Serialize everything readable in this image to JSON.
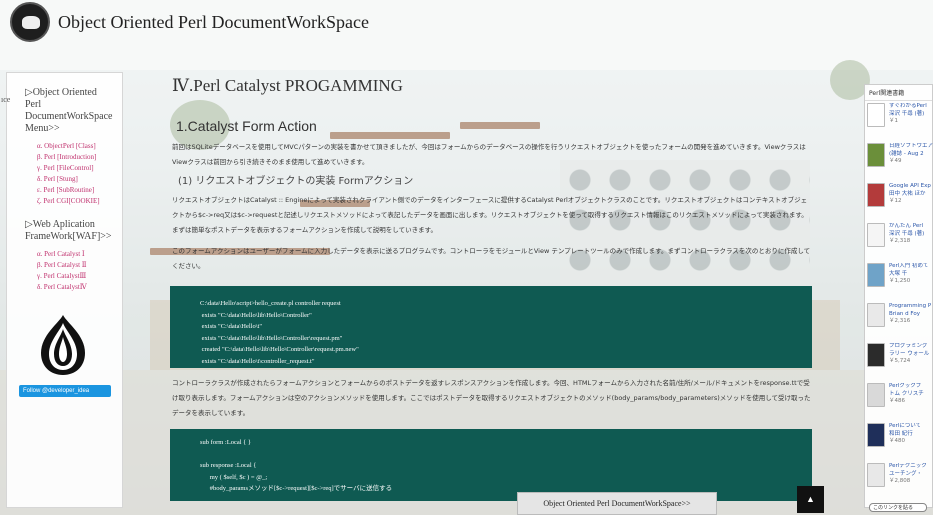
{
  "header": {
    "site_title": "Object Oriented Perl DocumentWorkSpace"
  },
  "left_sidebar": {
    "tab_fragment": "ıce",
    "section1_title": "▷Object Oriented Perl DocumentWorkSpace Menu>>",
    "section1_items": [
      "α. ObjectPerl [Class]",
      "β. Perl [Introduction]",
      "γ. Perl [FileControl]",
      "δ. Perl [Stung]",
      "ε. Perl [SubRoutine]",
      "ζ. Perl CGI[COOKIE]"
    ],
    "section2_title": "▷Web Aplication FrameWork[WAF]>>",
    "section2_items": [
      "α. Perl Catalyst Ⅰ",
      "β. Perl Catalyst Ⅱ",
      "γ. Perl CatalystⅢ",
      "δ. Perl CatalystⅣ"
    ],
    "follow_label": "Follow @developer_idea"
  },
  "main": {
    "chapter_title": "Ⅳ.Perl Catalyst PROGAMMING",
    "section_title": "1.Catalyst Form Action",
    "intro": "前回はSQLiteデータベースを使用してMVCパターンの実装を書かせて頂きましたが、今回はフォームからのデータベースの操作を行うリクエストオブジェクトを使ったフォームの開発を進めていきます。Viewクラスは Viewクラスは前回から引き続きそのまま使用して進めていきます。",
    "subsection_title": "(1) リクエストオブジェクトの実装 Formアクション",
    "para1": "リクエストオブジェクトはCatalyst :: Engineによって実装されクライアント側でのデータをインターフェースに提供するCatalyst Perlオブジェクトクラスのことです。リクエストオブジェクトはコンテキストオブジェクトから$c->req又は$c->requestと記述しリクエストメソッドによって表記したデータを画面に出します。リクエストオブジェクトを使って取得するリクエスト情報はこのリクエストメソッドによって実装されます。まずは簡単なポストデータを表示するフォームアクションを作成して説明をしていきます。",
    "para2": "このフォームアクションはユーザーがフォームに入力したデータを表示に送るプログラムです。コントローラをモジュールとView テンプレートツールのみで作成します。まずコントローラクラスを次のとおりに作成してください。",
    "code1": "C:\\data\\Hello\\script>hello_create.pl controller request\n exists \"C:\\data\\Hello\\lib\\Hello\\Controller\"\n exists \"C:\\data\\Hello\\t\"\n exists \"C:\\data\\Hello\\lib\\Hello\\Controller\\request.pm\"\n created \"C:\\data\\Hello\\lib\\Hello\\Controller\\request.pm.new\"\n exists \"C:\\data\\Hello\\t\\controller_request.t\"",
    "para3": "コントローラクラスが作成されたらフォームアクションとフォームからのポストデータを返すレスポンスアクションを作成します。今回、HTMLフォームから入力された名前/住所/メール/ドキュメントをresponse.ttで受け取り表示します。フォームアクションは空のアクションメソッドを使用します。ここではポストデータを取得するリクエストオブジェクトのメソッド(body_params/body_parameters)メソッドを使用して受け取ったデータを表示しています。",
    "code2": "sub form :Local { }\n\nsub response :Local {\n      my ( $self, $c ) = @_;\n      #body_paramsメソッド[$c->request][$c->req]でサーバに送信する"
  },
  "right_sidebar": {
    "title": "Perl関連書籍",
    "books": [
      {
        "title": "すぐわかるPerl",
        "author": "深沢 千尋 (著)",
        "price": "￥1",
        "color": "#ffffff"
      },
      {
        "title": "日経ソフトウエア",
        "author": "(雑誌 - Aug 2",
        "price": "￥49",
        "color": "#6b8f3a"
      },
      {
        "title": "Google API Exp",
        "author": "田中 大祐 ほか",
        "price": "￥12",
        "color": "#b33b3b"
      },
      {
        "title": "かんたん Perl",
        "author": "深沢 千尋 (著)",
        "price": "￥2,318",
        "color": "#f5f5f5"
      },
      {
        "title": "Perl入門 初めて",
        "author": "大塚 千",
        "price": "￥1,250",
        "color": "#6fa3c8"
      },
      {
        "title": "Programming P",
        "author": "Brian d Foy",
        "price": "￥2,316",
        "color": "#e9e9e9"
      },
      {
        "title": "プログラミング",
        "author": "ラリー ウォール",
        "price": "￥5,724",
        "color": "#2b2b2b"
      },
      {
        "title": "Perlクックブ",
        "author": "トム クリスチ",
        "price": "￥486",
        "color": "#d9d9d9"
      },
      {
        "title": "Perlについて",
        "author": "和田 紀行",
        "price": "￥480",
        "color": "#1f2f5a"
      },
      {
        "title": "Perlテクニック",
        "author": "ユーチング・",
        "price": "￥2,808",
        "color": "#e8e8e8"
      }
    ],
    "link_label": "このリンクを貼る"
  },
  "bottom_nav_label": "Object Oriented Perl DocumentWorkSpace>>",
  "to_top_label": "▲"
}
